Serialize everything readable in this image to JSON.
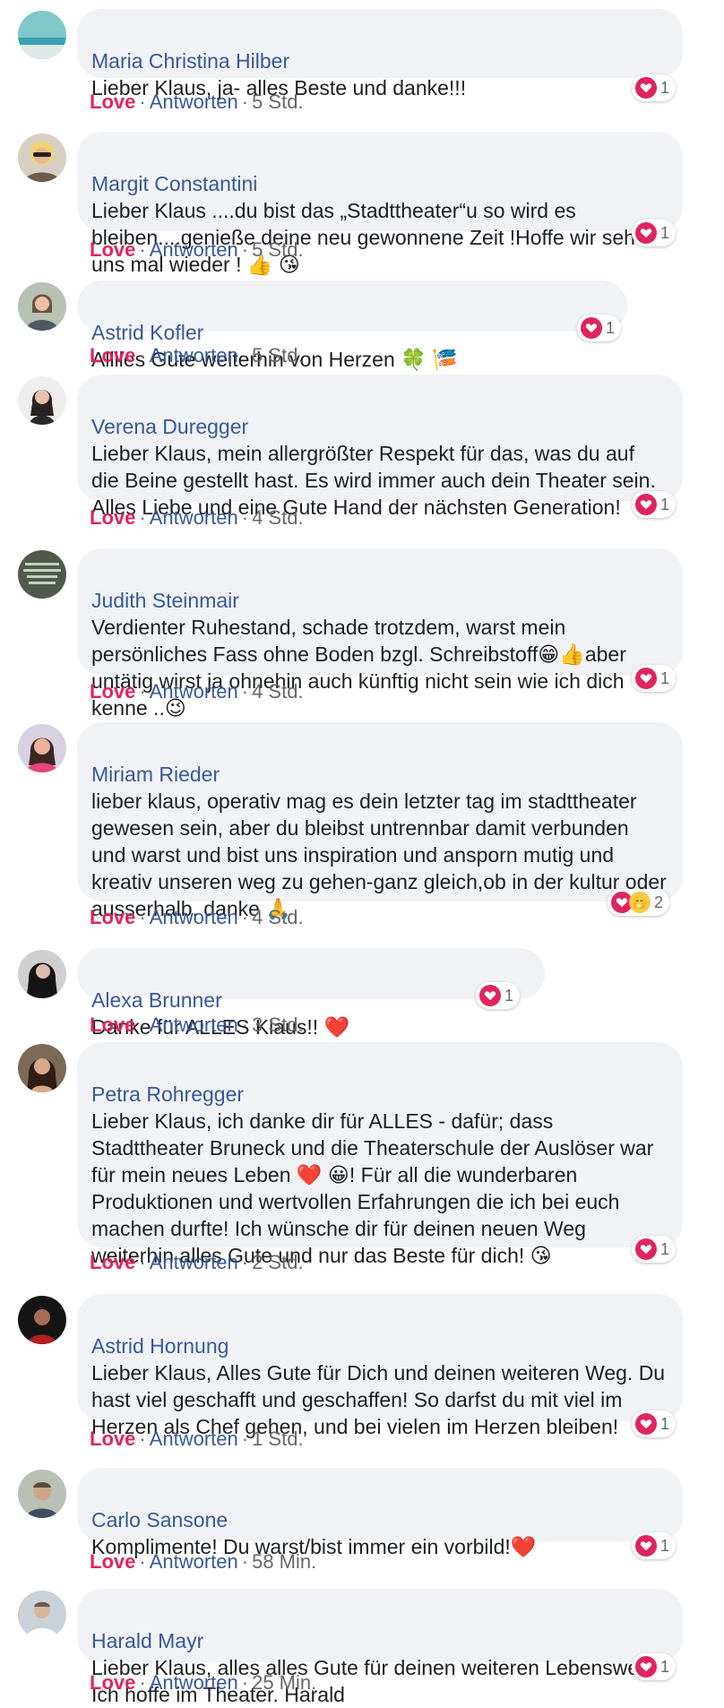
{
  "comments": [
    {
      "name": "Maria Christina Hilber",
      "text": "Lieber Klaus, ja- alles Beste und danke!!!",
      "love_label": "Love",
      "reply_label": "Antworten",
      "time": "5 Std.",
      "reactions": {
        "count": "1"
      }
    },
    {
      "name": "Margit Constantini",
      "text": "Lieber Klaus ....du bist das „Stadttheater“u so wird es bleiben....genieße deine neu gewonnene Zeit !Hoffe wir sehen uns mal wieder ! 👍 😘",
      "love_label": "Love",
      "reply_label": "Antworten",
      "time": "5 Std.",
      "reactions": {
        "count": "1"
      }
    },
    {
      "name": "Astrid Kofler",
      "text": "Alllles Gute weiterhin von Herzen 🍀 🎏",
      "love_label": "Love",
      "reply_label": "Antworten",
      "time": "5 Std.",
      "reactions": {
        "count": "1"
      }
    },
    {
      "name": "Verena Duregger",
      "text": "Lieber Klaus, mein allergrößter Respekt für das, was du auf die Beine gestellt hast. Es wird immer auch dein Theater sein. Alles Liebe und eine Gute Hand der nächsten Generation!",
      "love_label": "Love",
      "reply_label": "Antworten",
      "time": "4 Std.",
      "reactions": {
        "count": "1"
      }
    },
    {
      "name": "Judith Steinmair",
      "text": "Verdienter Ruhestand, schade trotzdem, warst mein persönliches Fass ohne Boden bzgl. Schreibstoff😁👍aber untätig wirst ja ohnehin auch künftig nicht sein wie ich dich kenne ..😉",
      "love_label": "Love",
      "reply_label": "Antworten",
      "time": "4 Std.",
      "reactions": {
        "count": "1"
      }
    },
    {
      "name": "Miriam Rieder",
      "text": "lieber klaus, operativ mag es dein letzter tag im stadttheater gewesen sein, aber du bleibst untrennbar damit verbunden und warst und bist uns inspiration und ansporn mutig und kreativ unseren weg zu gehen-ganz gleich,ob in der kultur oder ausserhalb. danke 🙏",
      "love_label": "Love",
      "reply_label": "Antworten",
      "time": "4 Std.",
      "reactions": {
        "count": "2"
      }
    },
    {
      "name": "Alexa Brunner",
      "text": "Danke für ALLES Klaus!! ❤️",
      "love_label": "Love",
      "reply_label": "Antworten",
      "time": "3 Std.",
      "reactions": {
        "count": "1"
      }
    },
    {
      "name": "Petra Rohregger",
      "text": "Lieber Klaus, ich danke dir für ALLES - dafür; dass Stadttheater Bruneck und die Theaterschule der Auslöser war für mein neues Leben ❤️ 😀! Für all die wunderbaren Produktionen und wertvollen Erfahrungen die ich bei euch machen durfte! Ich wünsche dir für deinen neuen Weg weiterhin alles Gute und nur das Beste für dich! 😘",
      "love_label": "Love",
      "reply_label": "Antworten",
      "time": "2 Std.",
      "reactions": {
        "count": "1"
      }
    },
    {
      "name": "Astrid Hornung",
      "text": "Lieber Klaus, Alles Gute für Dich und deinen weiteren Weg. Du hast viel geschafft und geschaffen! So darfst du mit viel im Herzen als Chef gehen, und bei vielen im Herzen bleiben!",
      "love_label": "Love",
      "reply_label": "Antworten",
      "time": "1 Std.",
      "reactions": {
        "count": "1"
      }
    },
    {
      "name": "Carlo Sansone",
      "text": "Komplimente! Du warst/bist immer ein vorbild!❤️",
      "love_label": "Love",
      "reply_label": "Antworten",
      "time": "58 Min.",
      "reactions": {
        "count": "1"
      }
    },
    {
      "name": "Harald Mayr",
      "text": "Lieber Klaus, alles alles Gute für deinen weiteren Lebensweg. Ich hoffe im Theater. Harald",
      "love_label": "Love",
      "reply_label": "Antworten",
      "time": "25 Min.",
      "reactions": {
        "count": "1"
      }
    }
  ],
  "colors": {
    "name": "#385898",
    "love": "#e0245e",
    "bubble": "#f0f2f5",
    "meta": "#65676b"
  }
}
